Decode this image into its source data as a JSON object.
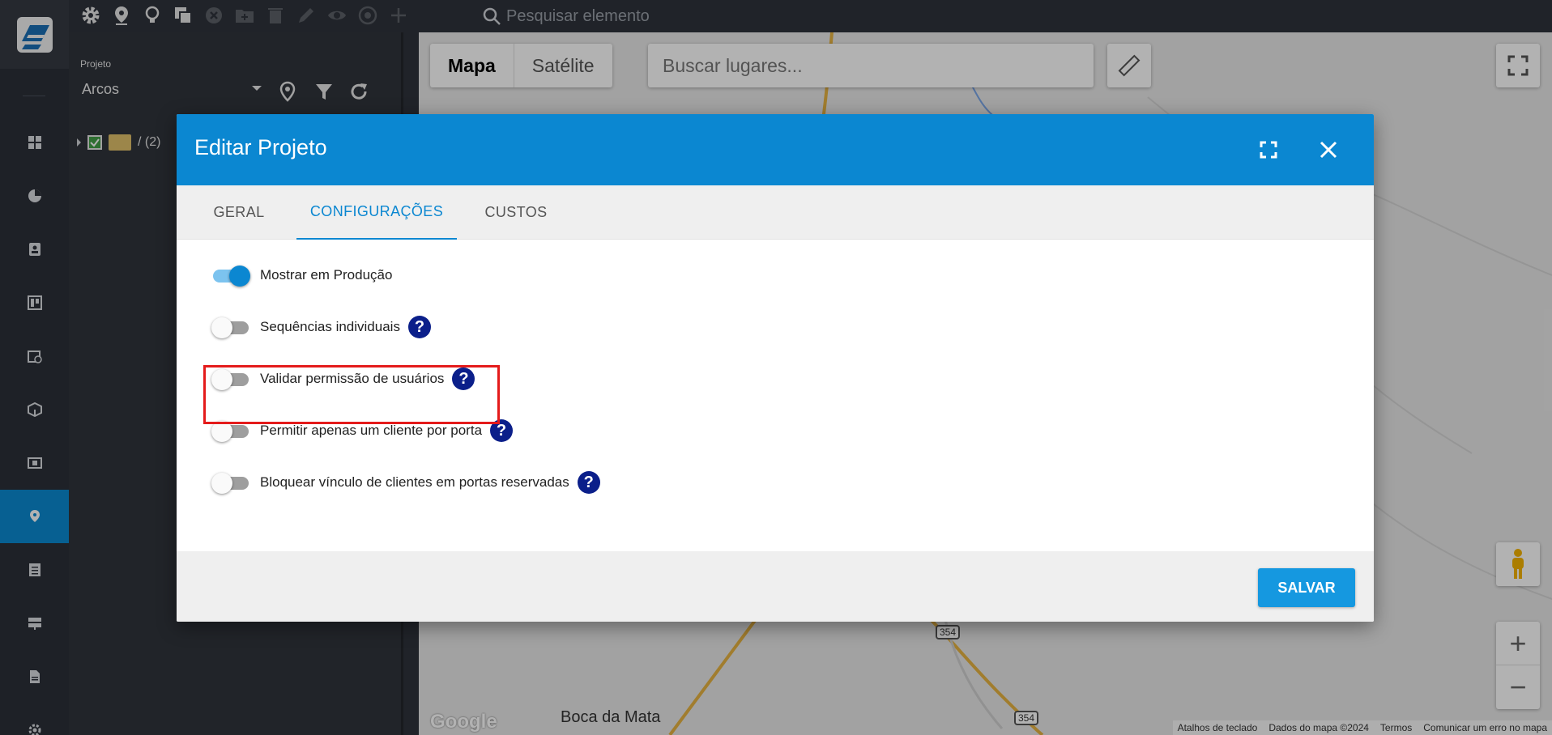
{
  "toolbar": {
    "search_placeholder": "Pesquisar elemento",
    "tools": [
      "gear-icon",
      "map-pin-icon",
      "lightbulb-icon",
      "copy-icon",
      "remove-icon",
      "new-folder-icon",
      "trash-icon",
      "pencil-icon",
      "eye-icon",
      "target-icon",
      "plus-icon"
    ]
  },
  "panel": {
    "project_label": "Projeto",
    "project_value": "Arcos",
    "tree_text": "/ (2)"
  },
  "map": {
    "type_options": [
      "Mapa",
      "Satélite"
    ],
    "search_placeholder": "Buscar lugares...",
    "place_label": "Boca da Mata",
    "road_shields": [
      "354",
      "354"
    ],
    "google_logo": "Google",
    "attribution": [
      "Atalhos de teclado",
      "Dados do mapa ©2024",
      "Termos",
      "Comunicar um erro no mapa"
    ],
    "zoom_in": "+",
    "zoom_out": "−"
  },
  "dialog": {
    "title": "Editar Projeto",
    "tabs": [
      "GERAL",
      "CONFIGURAÇÕES",
      "CUSTOS"
    ],
    "active_tab": "CONFIGURAÇÕES",
    "options": [
      {
        "label": "Mostrar em Produção",
        "on": true,
        "help": false
      },
      {
        "label": "Sequências individuais",
        "on": false,
        "help": true
      },
      {
        "label": "Validar permissão de usuários",
        "on": false,
        "help": true
      },
      {
        "label": "Permitir apenas um cliente por porta",
        "on": false,
        "help": true
      },
      {
        "label": "Bloquear vínculo de clientes em portas reservadas",
        "on": false,
        "help": true
      }
    ],
    "help_glyph": "?",
    "save_label": "SALVAR"
  },
  "colors": {
    "accent": "#0b87d1",
    "highlight": "#e41b1b",
    "help_bg": "#0b1f8a"
  }
}
